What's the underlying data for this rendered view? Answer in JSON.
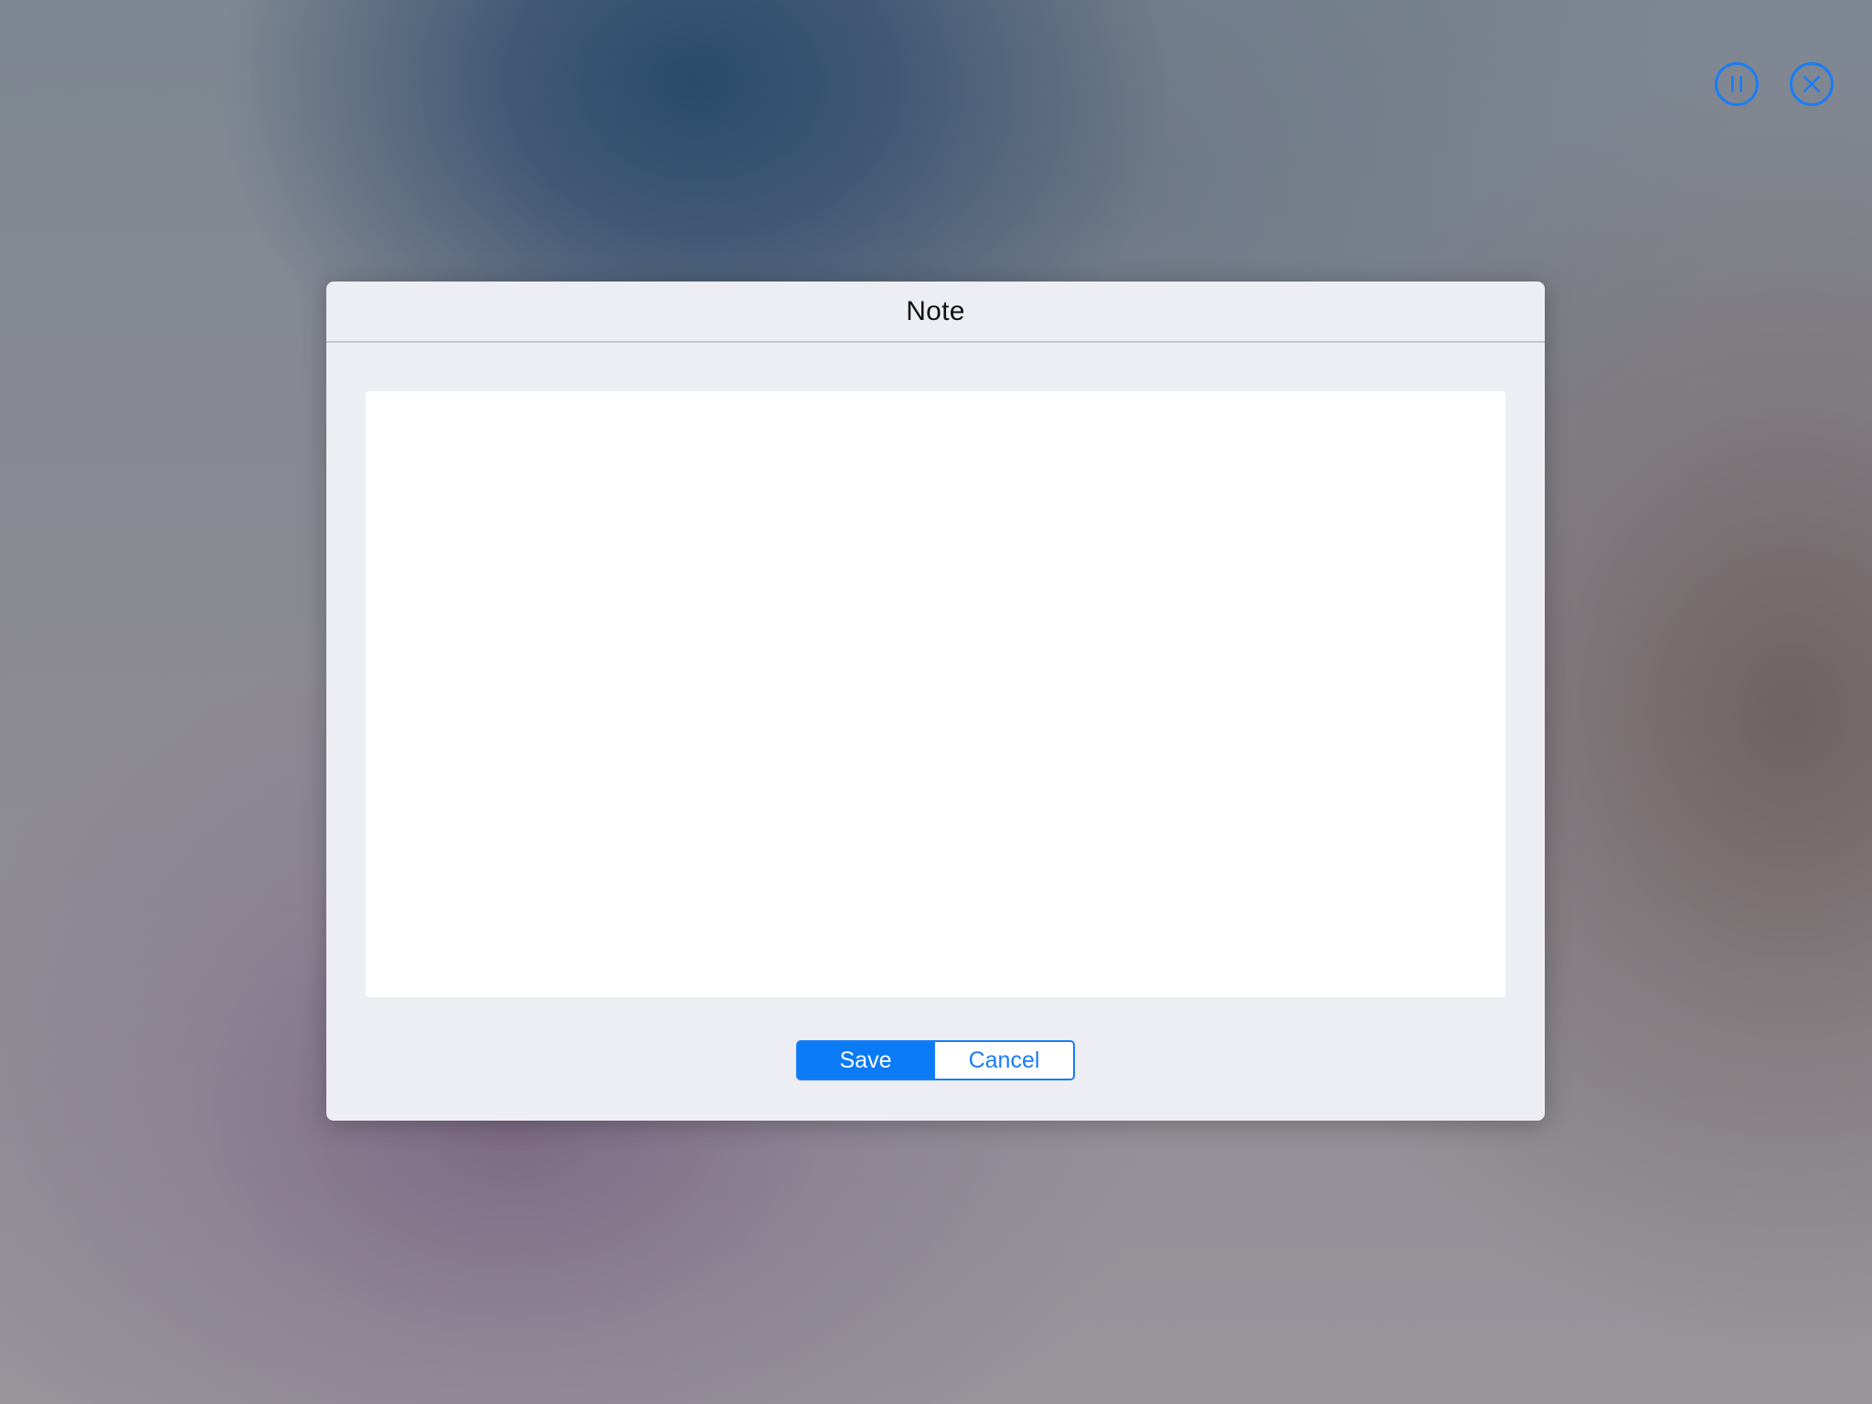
{
  "controls": {
    "pause_icon": "pause-circle-icon",
    "close_icon": "close-circle-icon",
    "accent_color": "#1a7cf5"
  },
  "dialog": {
    "title": "Note",
    "note_text": "",
    "save_label": "Save",
    "cancel_label": "Cancel",
    "primary_color": "#0a7af5",
    "background_color": "#edeef3"
  }
}
